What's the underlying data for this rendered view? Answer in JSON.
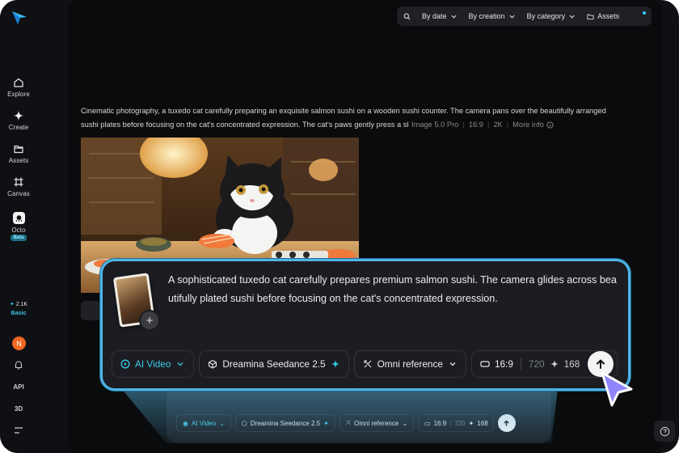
{
  "sidebar": {
    "items": [
      {
        "label": "Explore",
        "icon": "home-icon"
      },
      {
        "label": "Create",
        "icon": "sparkle-icon"
      },
      {
        "label": "Assets",
        "icon": "folder-icon"
      },
      {
        "label": "Canvas",
        "icon": "canvas-icon"
      },
      {
        "label": "Octo",
        "icon": "octo-icon",
        "badge": "Beta"
      }
    ],
    "credits": "2.1K",
    "plan": "Basic",
    "avatar_initial": "N",
    "api_label": "API",
    "three_d_label": "3D"
  },
  "filters": {
    "by_date": "By date",
    "by_creation": "By creation",
    "by_category": "By category",
    "assets": "Assets"
  },
  "generation": {
    "description_line1": "Cinematic photography, a tuxedo cat carefully preparing an exquisite salmon sushi on a wooden sushi counter. The camera pans over the beautifully arranged",
    "description_line2": "sushi plates before focusing on the cat's concentrated expression. The cat's paws gently press a slice of fresh salmon",
    "model": "Image 5.0 Pro",
    "ratio": "16:9",
    "resolution": "2K",
    "more_info": "More info"
  },
  "prompt_card": {
    "text": "A sophisticated tuxedo cat carefully prepares premium salmon sushi. The camera glides across beautifully plated sushi before focusing on the cat's concentrated expression.",
    "mode": "AI Video",
    "model": "Dreamina Seedance 2.5",
    "reference": "Omni reference",
    "ratio": "16:9",
    "resolution": "720",
    "credits": "168"
  },
  "colors": {
    "accent": "#3ccbe8",
    "highlight_border": "#4fb4e6",
    "avatar": "#f26722",
    "cursor": "#8f86ff"
  }
}
